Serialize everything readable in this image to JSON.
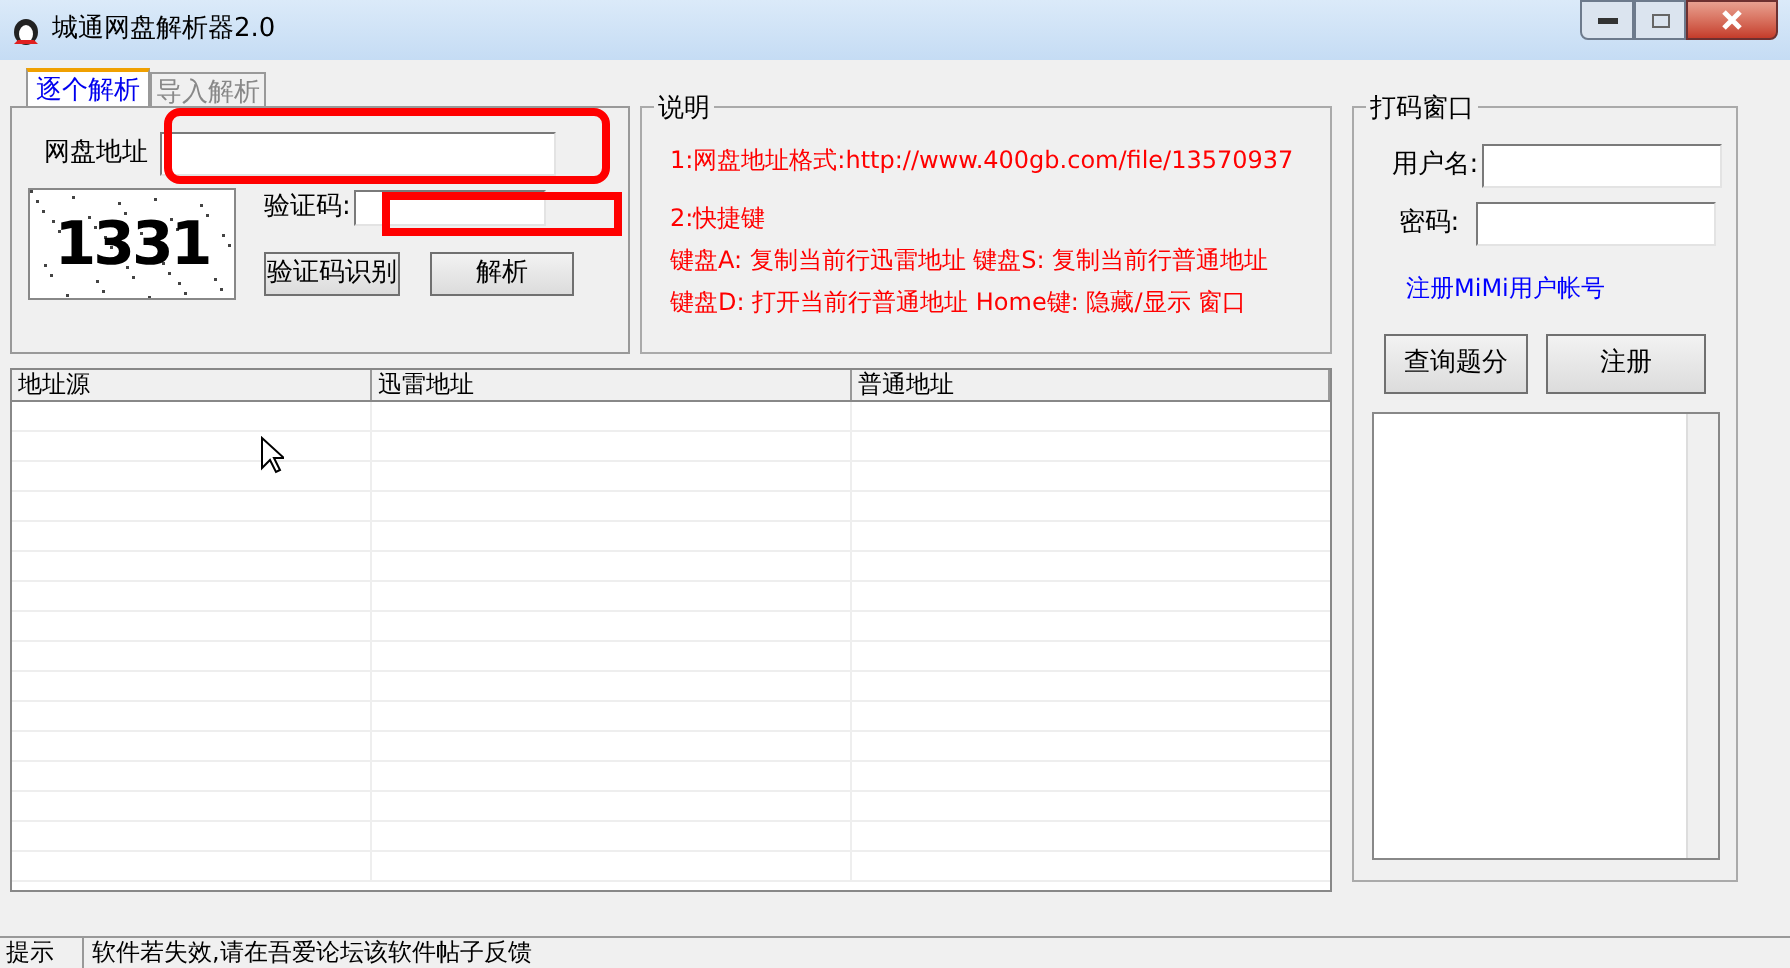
{
  "window": {
    "title": "城通网盘解析器2.0"
  },
  "tabs": [
    {
      "label": "逐个解析",
      "selected": true
    },
    {
      "label": "导入解析",
      "selected": false
    }
  ],
  "single": {
    "url_label": "网盘地址",
    "captcha_label": "验证码:",
    "captcha_text": "1331",
    "buttons": [
      "验证码识别",
      "解析"
    ]
  },
  "notes": {
    "title": "说明",
    "lines": [
      "1:网盘地址格式:http://www.400gb.com/file/13570937",
      "2:快捷键",
      "键盘A: 复制当前行迅雷地址 键盘S: 复制当前行普通地址",
      "键盘D: 打开当前行普通地址 Home键: 隐藏/显示 窗口"
    ]
  },
  "table": {
    "columns": [
      "地址源",
      "迅雷地址",
      "普通地址"
    ]
  },
  "captcha_panel": {
    "title": "打码窗口",
    "username_label": "用户名:",
    "password_label": "密码:",
    "register_link": "注册MiMi用户帐号",
    "buttons": [
      "查询题分",
      "注册"
    ]
  },
  "status_bar": {
    "label": "提示",
    "message": "软件若失效,请在吾爱论坛该软件帖子反馈"
  }
}
